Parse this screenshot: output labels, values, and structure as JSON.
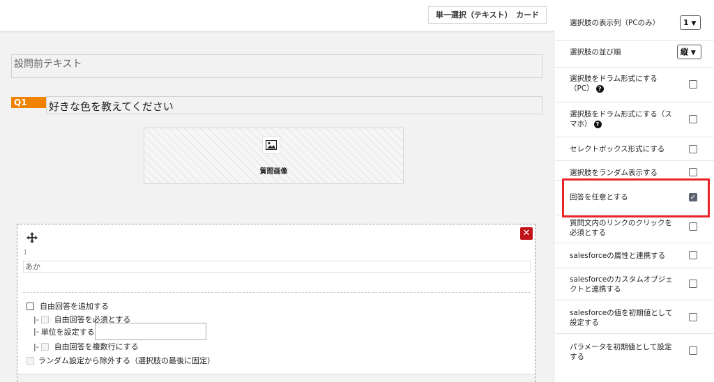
{
  "header": {
    "question_type": "単一選択（テキスト）　カード"
  },
  "question": {
    "pre_text_placeholder": "設問前テキスト",
    "number": "Q1",
    "title": "好きな色を教えてください",
    "image_label": "質問画像"
  },
  "choice": {
    "index": "1",
    "value": "あか",
    "options": {
      "add_free_answer": "自由回答を追加する",
      "free_required_prefix": "|-",
      "free_required": "自由回答を必須とする",
      "unit_prefix": "|-",
      "unit": "単位を設定する",
      "free_multiline_prefix": "|-",
      "free_multiline": "自由回答を複数行にする",
      "exclude_random": "ランダム設定から除外する（選択肢の最後に固定）"
    }
  },
  "sidebar": {
    "columns_label": "選択肢の表示列（PCのみ）",
    "columns_value": "1",
    "order_label": "選択肢の並び順",
    "order_value": "縦",
    "drum_pc_label": "選択肢をドラム形式にする（PC）",
    "drum_sp_label": "選択肢をドラム形式にする（スマホ）",
    "selectbox_label": "セレクトボックス形式にする",
    "random_label": "選択肢をランダム表示する",
    "optional_label": "回答を任意とする",
    "link_click_label": "質問文内のリンクのクリックを必須とする",
    "sf_attr_label": "salesforceの属性と連携する",
    "sf_custom_label": "salesforceのカスタムオブジェクトと連携する",
    "sf_default_label": "salesforceの値を初期値として設定する",
    "param_default_label": "パラメータを初期値として設定する",
    "optional_checked": true
  },
  "colors": {
    "accent": "#f08200",
    "delete": "#c0141a",
    "highlight": "#e8262a"
  },
  "icons": [
    "image-icon",
    "move-icon",
    "close-icon",
    "help-icon",
    "chevron-down-icon",
    "checkbox-icon"
  ]
}
